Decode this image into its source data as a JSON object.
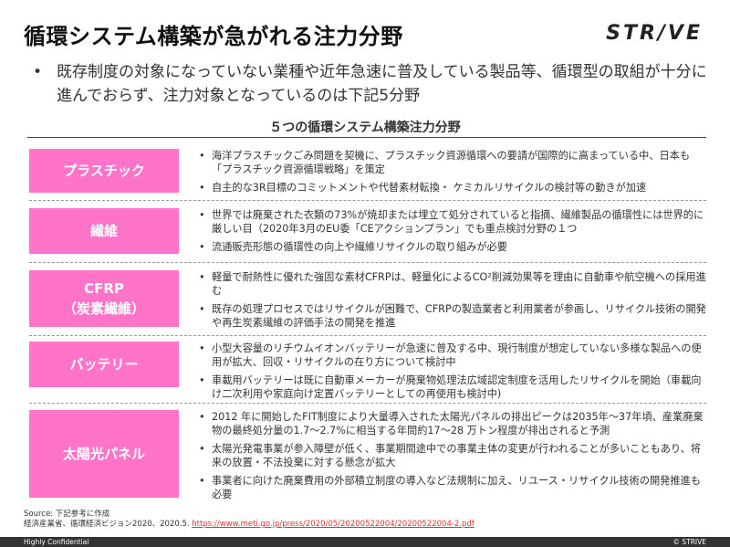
{
  "header": {
    "title": "循環システム構築が急がれる注力分野",
    "logo": "STR/VE"
  },
  "lead": "既存制度の対象になっていない業種や近年急速に普及している製品等、循環型の取組が十分に進んでおらず、注力対象となっているのは下記5分野",
  "table_title": "５つの循環システム構築注力分野",
  "rows": [
    {
      "label1": "プラスチック",
      "label2": "",
      "bullets": [
        "海洋プラスチックごみ問題を契機に、プラスチック資源循環への要請が国際的に高まっている中、日本も「プラスチック資源循環戦略」を策定",
        "自主的な3R目標のコミットメントや代替素材転換・ ケミカルリサイクルの検討等の動きが加速"
      ]
    },
    {
      "label1": "繊維",
      "label2": "",
      "bullets": [
        "世界では廃棄された衣類の73%が焼却または埋立て処分されていると指摘、繊維製品の循環性には世界的に厳しい目（2020年3月のEU委「CEアクションプラン」でも重点検討分野の１つ",
        "流通販売形態の循環性の向上や繊維リサイクルの取り組みが必要"
      ]
    },
    {
      "label1": "CFRP",
      "label2": "（炭素繊維）",
      "bullets": [
        "軽量で耐熱性に優れた強固な素材CFRPは、軽量化によるCO²削減効果等を理由に自動車や航空機への採用進む",
        "既存の処理プロセスではリサイクルが困難で、CFRPの製造業者と利用業者が参画し、リサイクル技術の開発や再生炭素繊維の評価手法の開発を推進"
      ]
    },
    {
      "label1": "バッテリー",
      "label2": "",
      "bullets": [
        "小型大容量のリチウムイオンバッテリーが急速に普及する中、現行制度が想定していない多様な製品への使用が拡大、回収・リサイクルの在り方について検討中",
        "車載用バッテリーは既に自動車メーカーが廃棄物処理法広域認定制度を活用したリサイクルを開始（車載向け二次利用や家庭向け定置バッテリーとしての再使用も検討中)"
      ]
    },
    {
      "label1": "太陽光パネル",
      "label2": "",
      "bullets": [
        "2012 年に開始したFIT制度により大量導入された太陽光パネルの排出ピークは2035年～37年頃、産業廃棄物の最終処分量の1.7～2.7%に相当する年間約17～28 万トン程度が排出されると予測",
        "太陽光発電事業が参入障壁が低く、事業期間途中での事業主体の変更が行われることが多いこともあり、将来の放置・不法投棄に対する懸念が拡大",
        "事業者に向けた廃棄費用の外部積立制度の導入など法規制に加え、リユース・リサイクル技術の開発推進も必要"
      ]
    }
  ],
  "source": {
    "line1": "Source: 下記参考に作成",
    "line2": "経済産業省、循環経済ビジョン2020、2020.5.",
    "link": "https://www.meti.go.jp/press/2020/05/20200522004/20200522004-2.pdf"
  },
  "footer": {
    "left": "Highly Confidential",
    "right": "© STRIVE"
  },
  "colors": {
    "label_bg": "#ff74c9",
    "footer_bg": "#333333"
  }
}
